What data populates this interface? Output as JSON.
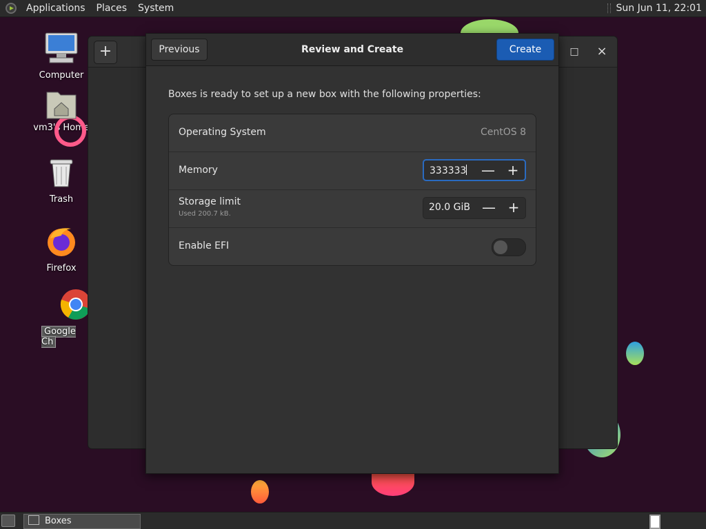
{
  "top_panel": {
    "menus": [
      "Applications",
      "Places",
      "System"
    ],
    "clock": "Sun Jun 11, 22:01"
  },
  "desktop": {
    "icons": [
      {
        "label": "Computer",
        "icon": "computer-icon"
      },
      {
        "label": "vm3's Home",
        "icon": "home-folder-icon"
      },
      {
        "label": "Trash",
        "icon": "trash-icon"
      },
      {
        "label": "Firefox",
        "icon": "firefox-icon"
      },
      {
        "label": "Google Ch",
        "icon": "chrome-icon"
      }
    ]
  },
  "background_window": {
    "add_symbol": "+",
    "maximize_symbol": "□",
    "close_symbol": "×"
  },
  "dialog": {
    "previous_label": "Previous",
    "title": "Review and Create",
    "create_label": "Create",
    "intro": "Boxes is ready to set up a new box with the following properties:",
    "rows": {
      "os": {
        "label": "Operating System",
        "value": "CentOS 8"
      },
      "memory": {
        "label": "Memory",
        "value": "333333"
      },
      "storage": {
        "label": "Storage limit",
        "sublabel": "Used 200.7 kB.",
        "value": "20.0 GiB"
      },
      "efi": {
        "label": "Enable EFI",
        "enabled": false
      }
    },
    "minus_symbol": "—",
    "plus_symbol": "+"
  },
  "bottom_panel": {
    "task_label": "Boxes"
  },
  "colors": {
    "accent": "#1b5cb3",
    "desktop_bg": "#2a0d24"
  }
}
